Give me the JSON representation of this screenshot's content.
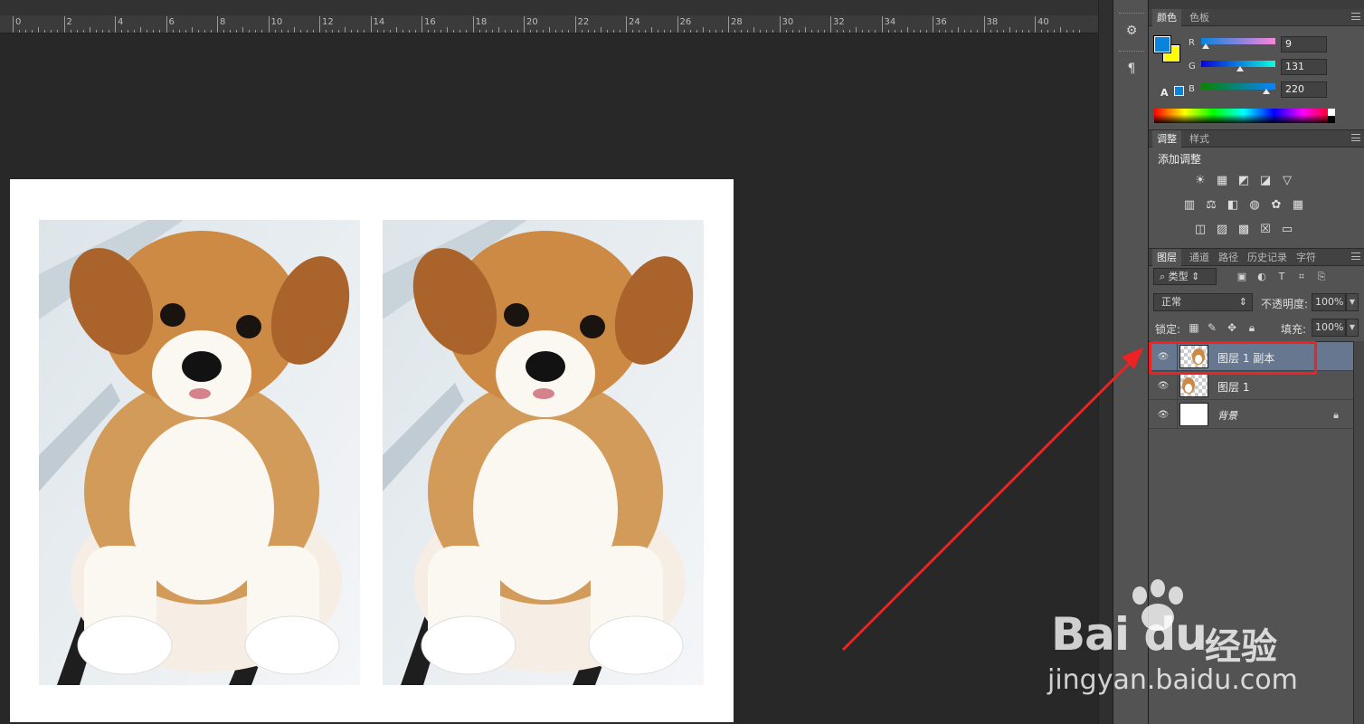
{
  "ruler": {
    "labels": [
      "0",
      "2",
      "4",
      "6",
      "8",
      "10",
      "12",
      "14",
      "16",
      "18",
      "20",
      "22",
      "24",
      "26",
      "28",
      "30",
      "32",
      "34",
      "36",
      "38",
      "40"
    ]
  },
  "color_panel": {
    "tabs": [
      "颜色",
      "色板"
    ],
    "channels": [
      {
        "label": "R",
        "value": "9"
      },
      {
        "label": "G",
        "value": "131"
      },
      {
        "label": "B",
        "value": "220"
      }
    ],
    "foreground_color": "#0983dc",
    "background_color": "#ffff00"
  },
  "adjustments_panel": {
    "tabs": [
      "调整",
      "样式"
    ],
    "title": "添加调整",
    "icons_row1": [
      "brightness-icon",
      "levels-icon",
      "curves-icon",
      "exposure-icon",
      "vibrance-icon"
    ],
    "icons_row2": [
      "hue-saturation-icon",
      "color-balance-icon",
      "black-white-icon",
      "photo-filter-icon",
      "channel-mixer-icon",
      "color-lookup-icon"
    ],
    "icons_row3": [
      "invert-icon",
      "posterize-icon",
      "threshold-icon",
      "selective-color-icon",
      "gradient-map-icon"
    ]
  },
  "layers_panel": {
    "tabs": [
      "图层",
      "通道",
      "路径",
      "历史记录",
      "字符"
    ],
    "filter_type": "类型",
    "blend_mode": "正常",
    "opacity_label": "不透明度:",
    "opacity_value": "100%",
    "lock_label": "锁定:",
    "fill_label": "填充:",
    "fill_value": "100%",
    "layers": [
      {
        "name": "图层 1 副本",
        "selected": true
      },
      {
        "name": "图层 1",
        "selected": false
      },
      {
        "name": "背景",
        "selected": false,
        "locked": true
      }
    ]
  },
  "watermark": {
    "brand": "Bai du",
    "brand_cn": "经验",
    "url": "jingyan.baidu.com"
  }
}
